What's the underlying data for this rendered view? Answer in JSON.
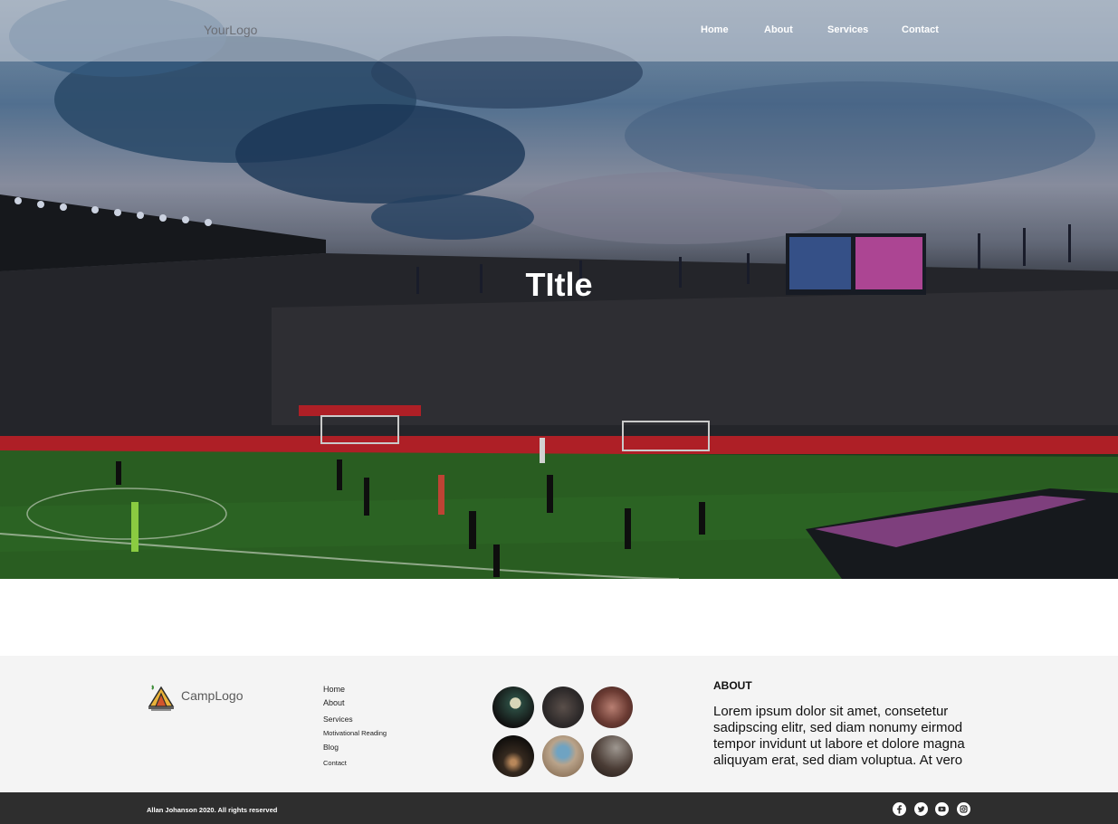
{
  "header": {
    "logo": "YourLogo",
    "nav": [
      "Home",
      "About",
      "Services",
      "Contact"
    ]
  },
  "hero": {
    "title": "TItle"
  },
  "footer": {
    "logo_text": "CampLogo",
    "links": [
      "Home",
      "About",
      "Services",
      "Motivational Reading",
      "Blog",
      "Contact"
    ],
    "gallery_count": 6,
    "about_heading": "ABOUT",
    "about_text": "Lorem ipsum dolor sit amet, consetetur sadipscing elitr, sed diam nonumy eirmod tempor invidunt ut labore et dolore magna aliquyam erat, sed diam voluptua. At vero"
  },
  "bottom_bar": {
    "copyright": "Allan Johanson 2020. All rights reserved",
    "social_icons": [
      "facebook-icon",
      "twitter-icon",
      "youtube-icon",
      "instagram-icon"
    ]
  },
  "colors": {
    "navbar_overlay": "#cdd2da",
    "footer_bg": "#f4f4f4",
    "bottom_bar_bg": "#2e2e2e",
    "pitch_green": "#2f6a26"
  }
}
